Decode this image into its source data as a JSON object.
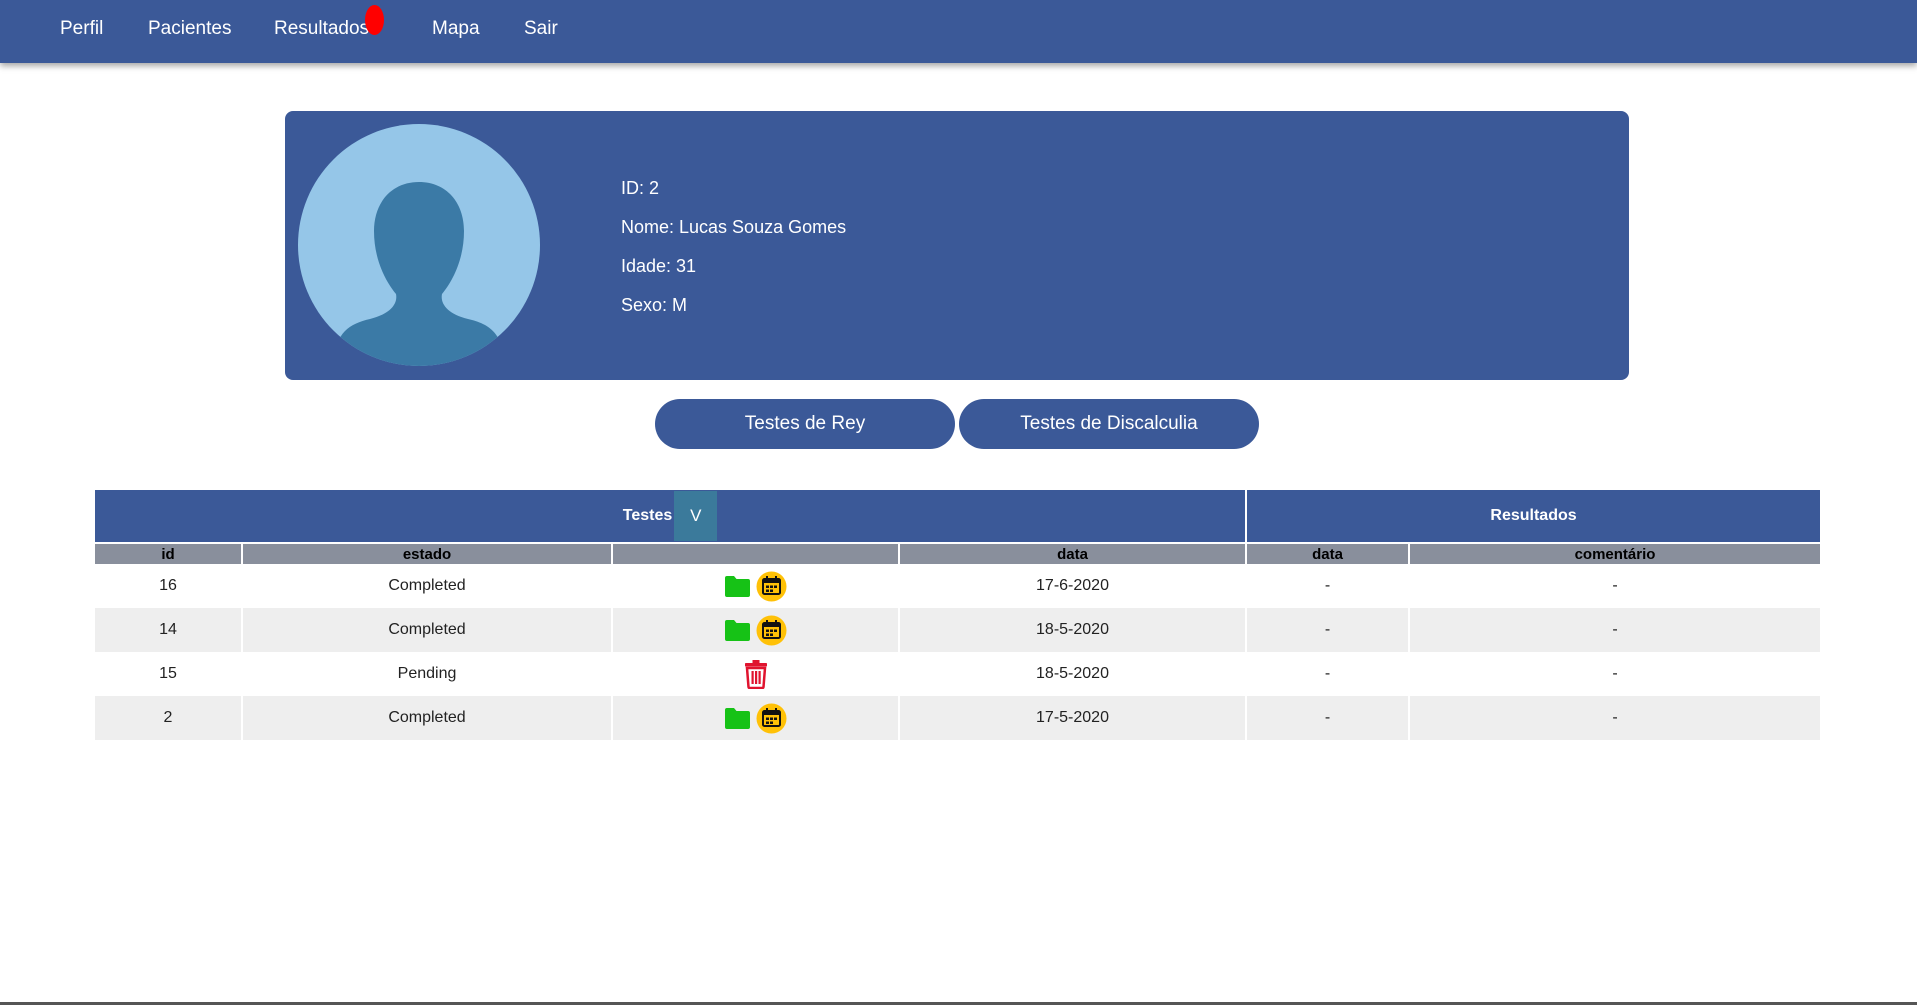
{
  "nav": {
    "items": [
      "Perfil",
      "Pacientes",
      "Resultados",
      "Mapa",
      "Sair"
    ]
  },
  "patient": {
    "id_line": "ID: 2",
    "name_line": "Nome: Lucas Souza Gomes",
    "age_line": "Idade: 31",
    "sex_line": "Sexo: M"
  },
  "buttons": {
    "rey": "Testes de Rey",
    "discalculia": "Testes de Discalculia"
  },
  "table": {
    "group_tests": "Testes",
    "toggle": "V",
    "group_results": "Resultados",
    "columns": [
      "id",
      "estado",
      "",
      "data",
      "data",
      "comentário"
    ],
    "rows": [
      {
        "id": "16",
        "estado": "Completed",
        "actions": [
          "folder-icon",
          "calendar-icon"
        ],
        "data": "17-6-2020",
        "res_data": "-",
        "comentario": "-"
      },
      {
        "id": "14",
        "estado": "Completed",
        "actions": [
          "folder-icon",
          "calendar-icon"
        ],
        "data": "18-5-2020",
        "res_data": "-",
        "comentario": "-"
      },
      {
        "id": "15",
        "estado": "Pending",
        "actions": [
          "trash-icon"
        ],
        "data": "18-5-2020",
        "res_data": "-",
        "comentario": "-"
      },
      {
        "id": "2",
        "estado": "Completed",
        "actions": [
          "folder-icon",
          "calendar-icon"
        ],
        "data": "17-5-2020",
        "res_data": "-",
        "comentario": "-"
      }
    ]
  },
  "colors": {
    "primary": "#3b5998",
    "toggle": "#3b7a9b",
    "column_header": "#898f9c",
    "row_alt": "#eeeeee",
    "notification": "#ff0000",
    "folder": "#16c216",
    "calendar_badge": "#ffc107",
    "trash": "#e0142f",
    "avatar_bg": "#95c6e8",
    "avatar_fg": "#3b7aa6"
  }
}
